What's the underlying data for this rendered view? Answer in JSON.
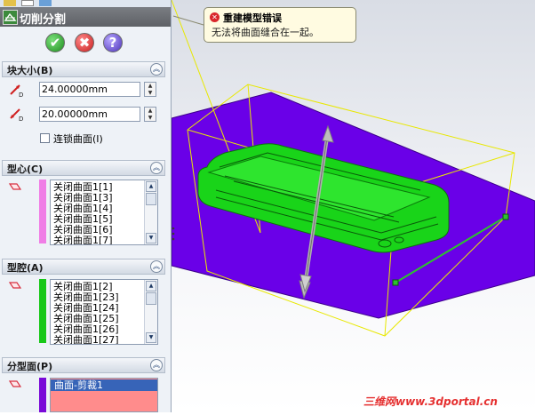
{
  "panel": {
    "title": "切削分割",
    "actions": {
      "ok": "✔",
      "cancel": "✖",
      "help": "?"
    },
    "block_size": {
      "header": "块大小(B)",
      "depth_a": "24.00000mm",
      "depth_b": "20.00000mm",
      "link_checkbox_label": "连锁曲面(I)",
      "link_checked": false
    },
    "core": {
      "header": "型心(C)",
      "color": "#f07ee6",
      "items": [
        "关闭曲面1[1]",
        "关闭曲面1[3]",
        "关闭曲面1[4]",
        "关闭曲面1[5]",
        "关闭曲面1[6]",
        "关闭曲面1[7]"
      ]
    },
    "cavity": {
      "header": "型腔(A)",
      "color": "#18c818",
      "items": [
        "关闭曲面1[2]",
        "关闭曲面1[23]",
        "关闭曲面1[24]",
        "关闭曲面1[25]",
        "关闭曲面1[26]",
        "关闭曲面1[27]"
      ]
    },
    "parting": {
      "header": "分型面(P)",
      "color": "#7a0ad8",
      "items": [
        "曲面-剪裁1"
      ]
    }
  },
  "tooltip": {
    "title": "重建模型错误",
    "message": "无法将曲面缝合在一起。"
  },
  "watermark": "三维网www.3dportal.cn",
  "colors": {
    "parting_surface": "#6a00e8",
    "part": "#19d419",
    "bounding_box": "#e8e800",
    "handle": "#a0a0a0",
    "selection_accent": "#2f62b3",
    "selected_item_bg": "#3764b8",
    "parting_list_bg": "#ff8c8c"
  }
}
